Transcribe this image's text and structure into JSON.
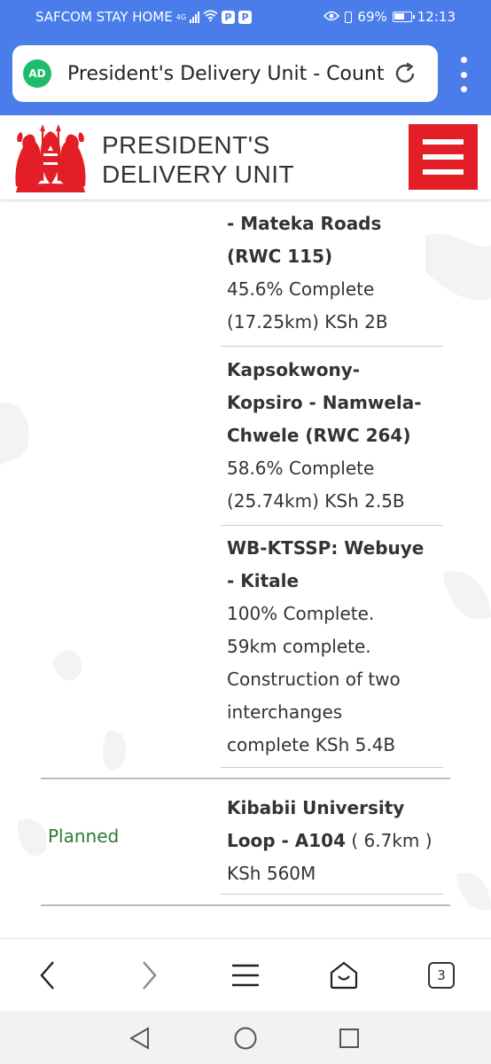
{
  "status_bar": {
    "carrier": "SAFCOM STAY HOME",
    "network": "4G",
    "signal_level": 4,
    "badge_1": "P",
    "badge_2": "P",
    "battery_percent": "69%",
    "battery_level": 0.69,
    "time": "12:13"
  },
  "browser": {
    "url_text": "President's Delivery Unit - County",
    "site_icon_label": "AD",
    "open_tabs": "3"
  },
  "site": {
    "title_line1": "PRESIDENT'S",
    "title_line2": "DELIVERY UNIT"
  },
  "projects": [
    {
      "name_lines": [
        "- Mateka Roads",
        "(RWC 115)"
      ],
      "detail_lines": [
        "45.6% Complete",
        "(17.25km) KSh 2B"
      ]
    },
    {
      "name_lines": [
        "Kapsokwony-",
        "Kopsiro - Namwela-",
        "Chwele (RWC 264)"
      ],
      "detail_lines": [
        "58.6% Complete",
        "(25.74km) KSh 2.5B"
      ]
    },
    {
      "name_lines": [
        "WB-KTSSP: Webuye",
        "- Kitale"
      ],
      "detail_lines": [
        "100% Complete.",
        "59km complete.",
        "Construction of two",
        "interchanges",
        "complete KSh 5.4B"
      ]
    }
  ],
  "planned_row": {
    "status": "Planned",
    "name_line1": "Kibabii University",
    "name_line2": "Loop - A104",
    "length": " ( 6.7km )",
    "cost": "KSh 560M"
  },
  "colors": {
    "browser_blue": "#4a7dea",
    "menu_red": "#e41e26",
    "planned_green": "#2d7a32"
  }
}
